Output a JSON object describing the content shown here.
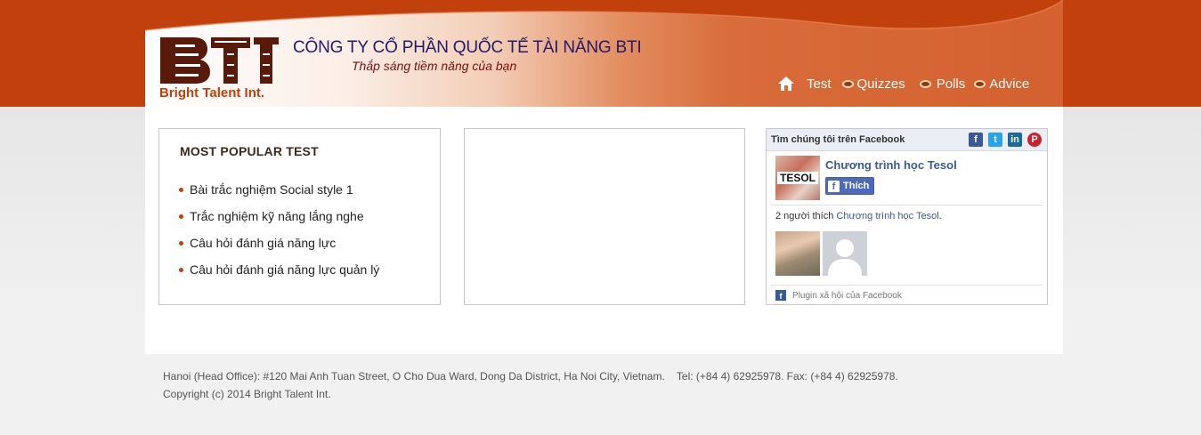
{
  "header": {
    "logo_text": "BTI",
    "logo_tagline": "Bright Talent Int.",
    "company_name": "CÔNG TY CỔ PHẦN QUỐC TẾ TÀI NĂNG BTI",
    "slogan": "Thắp sáng tiềm năng của bạn"
  },
  "nav": {
    "home_icon": "home-icon",
    "items": [
      {
        "label": "Test"
      },
      {
        "label": "Quizzes"
      },
      {
        "label": "Polls"
      },
      {
        "label": "Advice"
      }
    ]
  },
  "popular": {
    "title": "MOST POPULAR TEST",
    "items": [
      "Bài trắc nghiệm Social style 1",
      "Trắc nghiệm kỹ năng lắng nghe",
      "Câu hỏi đánh giá năng lực",
      "Câu hỏi đánh giá năng lực quản lý"
    ]
  },
  "facebook": {
    "header_title": "Tìm chúng tôi trên Facebook",
    "social_icons": [
      "facebook-icon",
      "twitter-icon",
      "linkedin-icon",
      "pinterest-icon"
    ],
    "page_thumb_label": "TESOL",
    "page_name": "Chương trình học Tesol",
    "like_button": "Thích",
    "like_count_prefix": "2 người thích ",
    "like_count_link": "Chương trình học Tesol",
    "like_count_suffix": ".",
    "footer_label": "Plugin xã hội của Facebook"
  },
  "footer": {
    "address": "Hanoi (Head Office): #120 Mai Anh Tuan Street, O Cho Dua Ward, Dong Da District, Ha Noi City, Vietnam.    Tel: (+84 4) 62925978. Fax: (+84 4) 62925978.",
    "copyright": "Copyright (c) 2014 Bright Talent Int."
  },
  "colors": {
    "brand_orange": "#c1400c",
    "company_navy": "#241a6a",
    "facebook_blue": "#3b5998"
  }
}
